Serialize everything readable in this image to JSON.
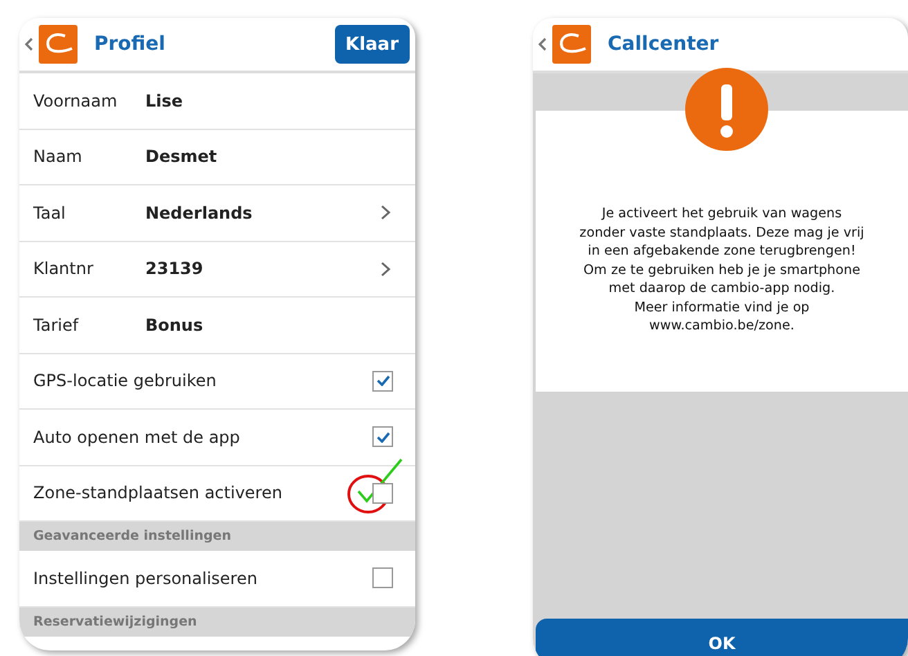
{
  "profile_screen": {
    "title": "Profiel",
    "done_button": "Klaar",
    "rows": [
      {
        "kind": "field",
        "label": "Voornaam",
        "value": "Lise",
        "chevron": false
      },
      {
        "kind": "field",
        "label": "Naam",
        "value": "Desmet",
        "chevron": false
      },
      {
        "kind": "field",
        "label": "Taal",
        "value": "Nederlands",
        "chevron": true
      },
      {
        "kind": "field",
        "label": "Klantnr",
        "value": "23139",
        "chevron": true
      },
      {
        "kind": "field",
        "label": "Tarief",
        "value": "Bonus",
        "chevron": false
      },
      {
        "kind": "checkbox",
        "label": "GPS-locatie gebruiken",
        "checked": true,
        "highlighted": false
      },
      {
        "kind": "checkbox",
        "label": "Auto openen met de app",
        "checked": true,
        "highlighted": false
      },
      {
        "kind": "checkbox",
        "label": "Zone-standplaatsen activeren",
        "checked": false,
        "highlighted": true
      },
      {
        "kind": "section",
        "label": "Geavanceerde instellingen"
      },
      {
        "kind": "checkbox",
        "label": "Instellingen personaliseren",
        "checked": false,
        "highlighted": false
      },
      {
        "kind": "section",
        "label": "Reservatiewijzigingen"
      }
    ]
  },
  "callcenter_screen": {
    "title": "Callcenter",
    "message_lines": [
      "Je activeert het gebruik van wagens",
      "zonder vaste standplaats. Deze mag je vrij",
      "in een afgebakende zone terugbrengen!",
      "Om ze te gebruiken heb je je smartphone",
      "met daarop de cambio-app nodig.",
      "Meer informatie vind je op",
      "www.cambio.be/zone."
    ],
    "ok_button": "OK"
  }
}
